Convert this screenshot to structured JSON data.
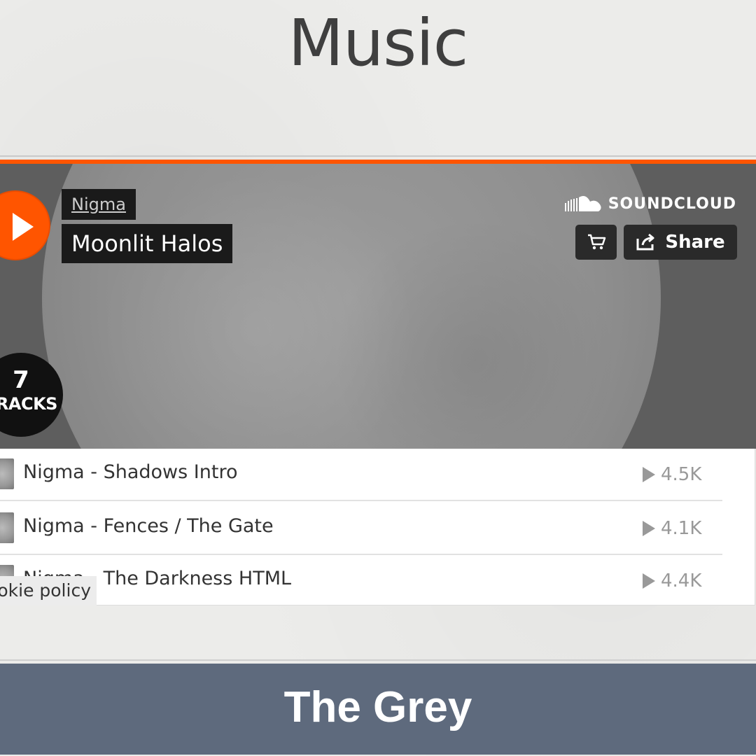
{
  "page": {
    "title": "Music",
    "section_title": "The Grey",
    "cookie_label": "okie policy"
  },
  "player": {
    "artist": "Nigma",
    "playlist_title": "Moonlit Halos",
    "brand": "SOUNDCLOUD",
    "share_label": "Share",
    "track_count": "7",
    "track_count_label": "TRACKS",
    "accent_color": "#ff5500",
    "icons": {
      "play": "play-icon",
      "cart": "cart-icon",
      "share": "share-icon",
      "logo": "soundcloud-logo-icon"
    }
  },
  "tracks": [
    {
      "name": "Nigma - Shadows Intro",
      "plays": "4.5K"
    },
    {
      "name": "Nigma - Fences / The Gate",
      "plays": "4.1K"
    },
    {
      "name": "Nigma - The Darkness HTML",
      "plays": "4.4K"
    }
  ]
}
